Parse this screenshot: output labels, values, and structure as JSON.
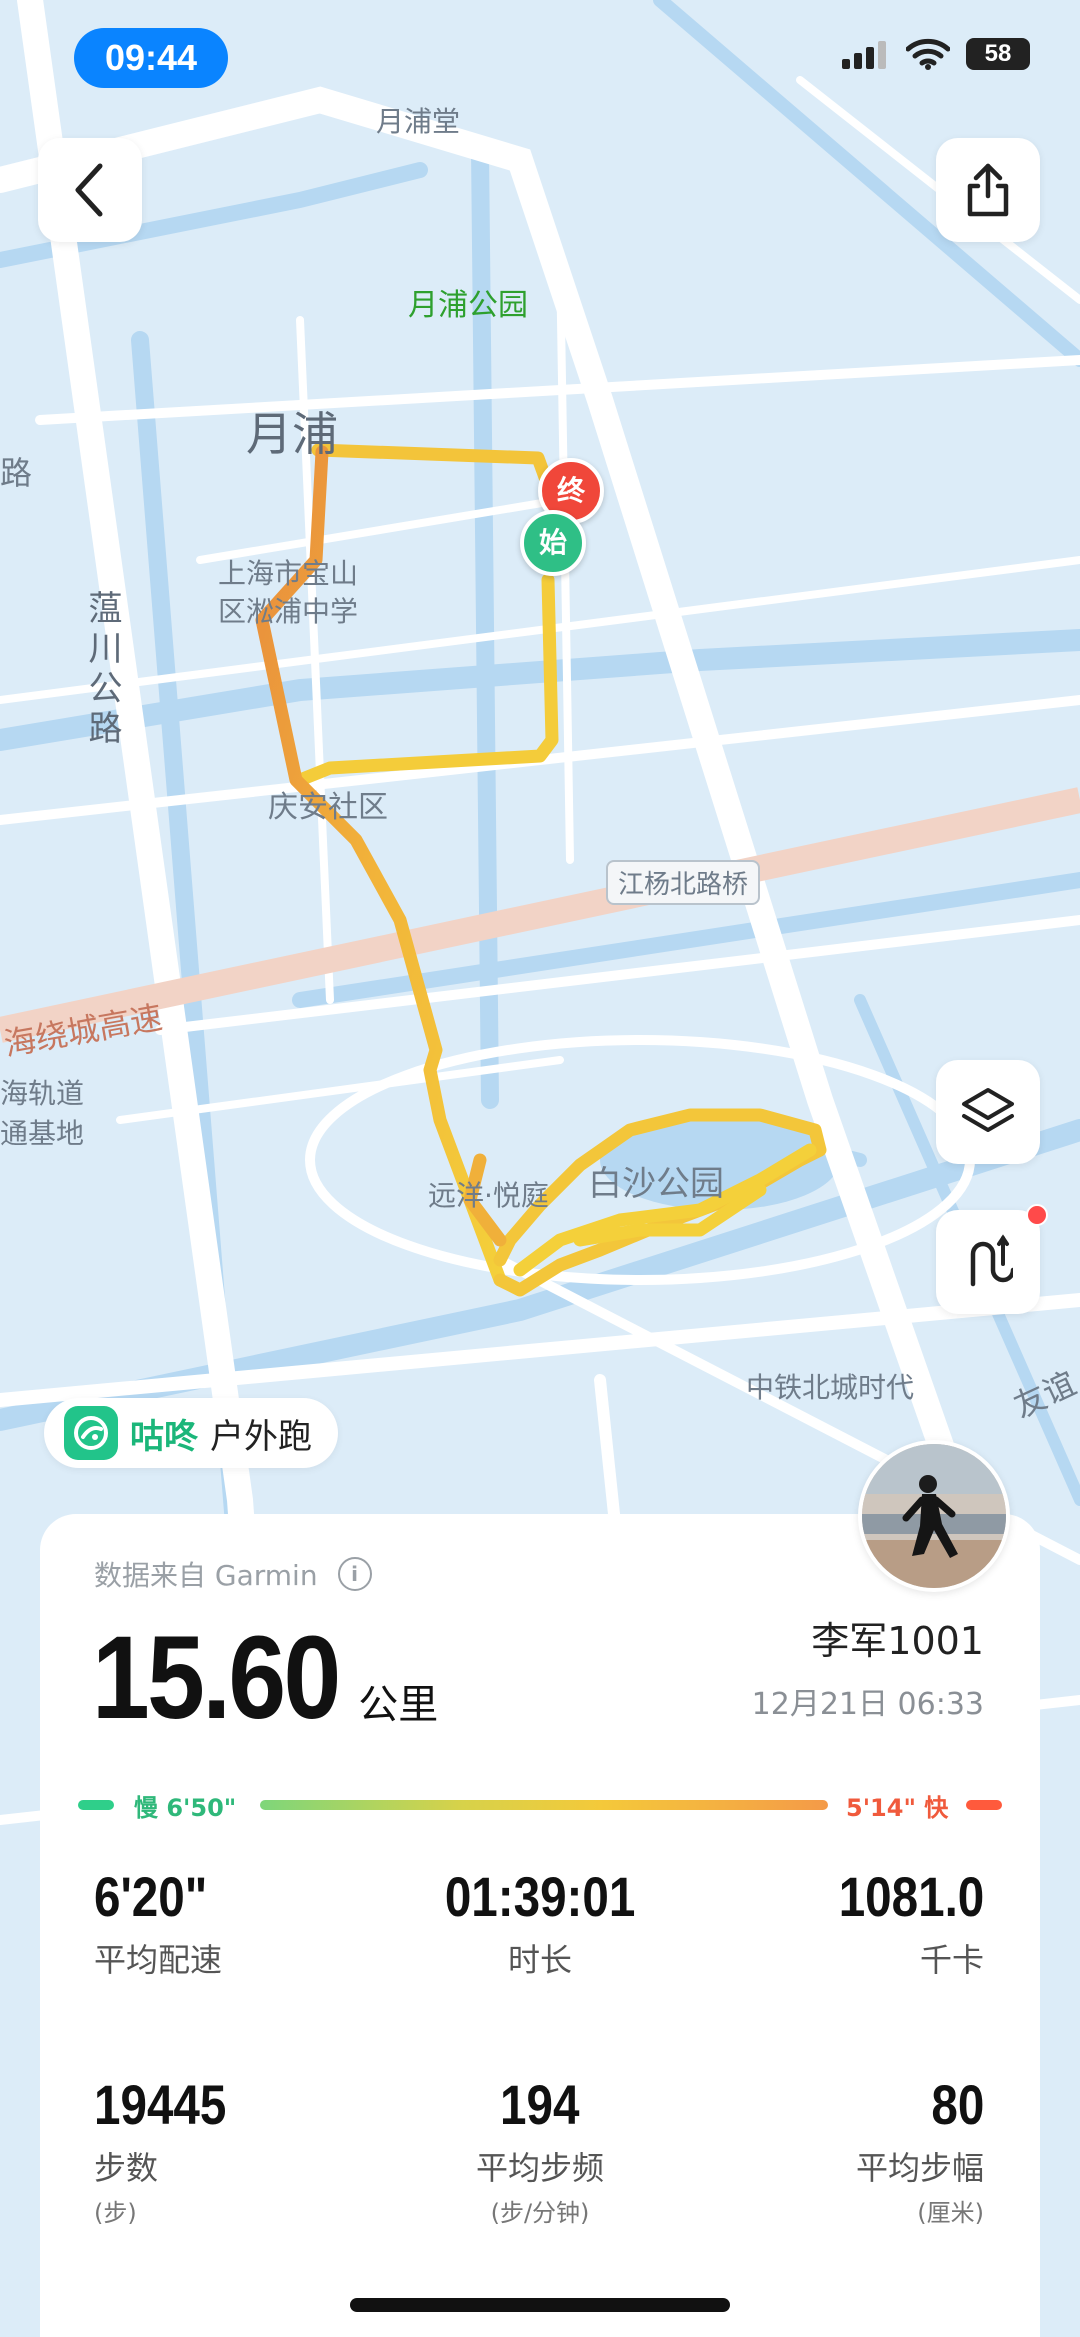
{
  "status_bar": {
    "time": "09:44",
    "battery": "58"
  },
  "map": {
    "labels": {
      "yuepu_hall": "月浦堂",
      "yuepu_park": "月浦公园",
      "yuepu": "月浦",
      "school": "上海市宝山区淞浦中学",
      "school_line1": "上海市宝山",
      "school_line2": "区淞浦中学",
      "wenchuan_road": "蕰川公路",
      "qingan": "庆安社区",
      "bridge": "江杨北路桥",
      "highway": "海绕城高速",
      "metro_line1": "海轨道",
      "metro_line2": "通基地",
      "yuanyang": "远洋·悦庭",
      "baisha_park": "白沙公园",
      "zhongtie": "中铁北城时代",
      "youyi": "友谊",
      "road_left": "路"
    },
    "markers": {
      "start": "始",
      "end": "终"
    }
  },
  "app": {
    "name": "咕咚",
    "activity": "户外跑"
  },
  "summary": {
    "source": "数据来自 Garmin",
    "distance": "15.60",
    "distance_unit": "公里",
    "user_name": "李军1001",
    "date": "12月21日 06:33",
    "pace_slow": "慢 6'50\"",
    "pace_fast": "5'14\" 快",
    "colors": {
      "slow": "#2fcf8a",
      "fast": "#ff5a3c",
      "mid": "#f4c93a"
    }
  },
  "metrics": [
    {
      "value": "6'20\"",
      "label": "平均配速",
      "sub": ""
    },
    {
      "value": "01:39:01",
      "label": "时长",
      "sub": ""
    },
    {
      "value": "1081.0",
      "label": "千卡",
      "sub": ""
    },
    {
      "value": "19445",
      "label": "步数",
      "sub": "(步)"
    },
    {
      "value": "194",
      "label": "平均步频",
      "sub": "(步/分钟)"
    },
    {
      "value": "80",
      "label": "平均步幅",
      "sub": "(厘米)"
    }
  ]
}
